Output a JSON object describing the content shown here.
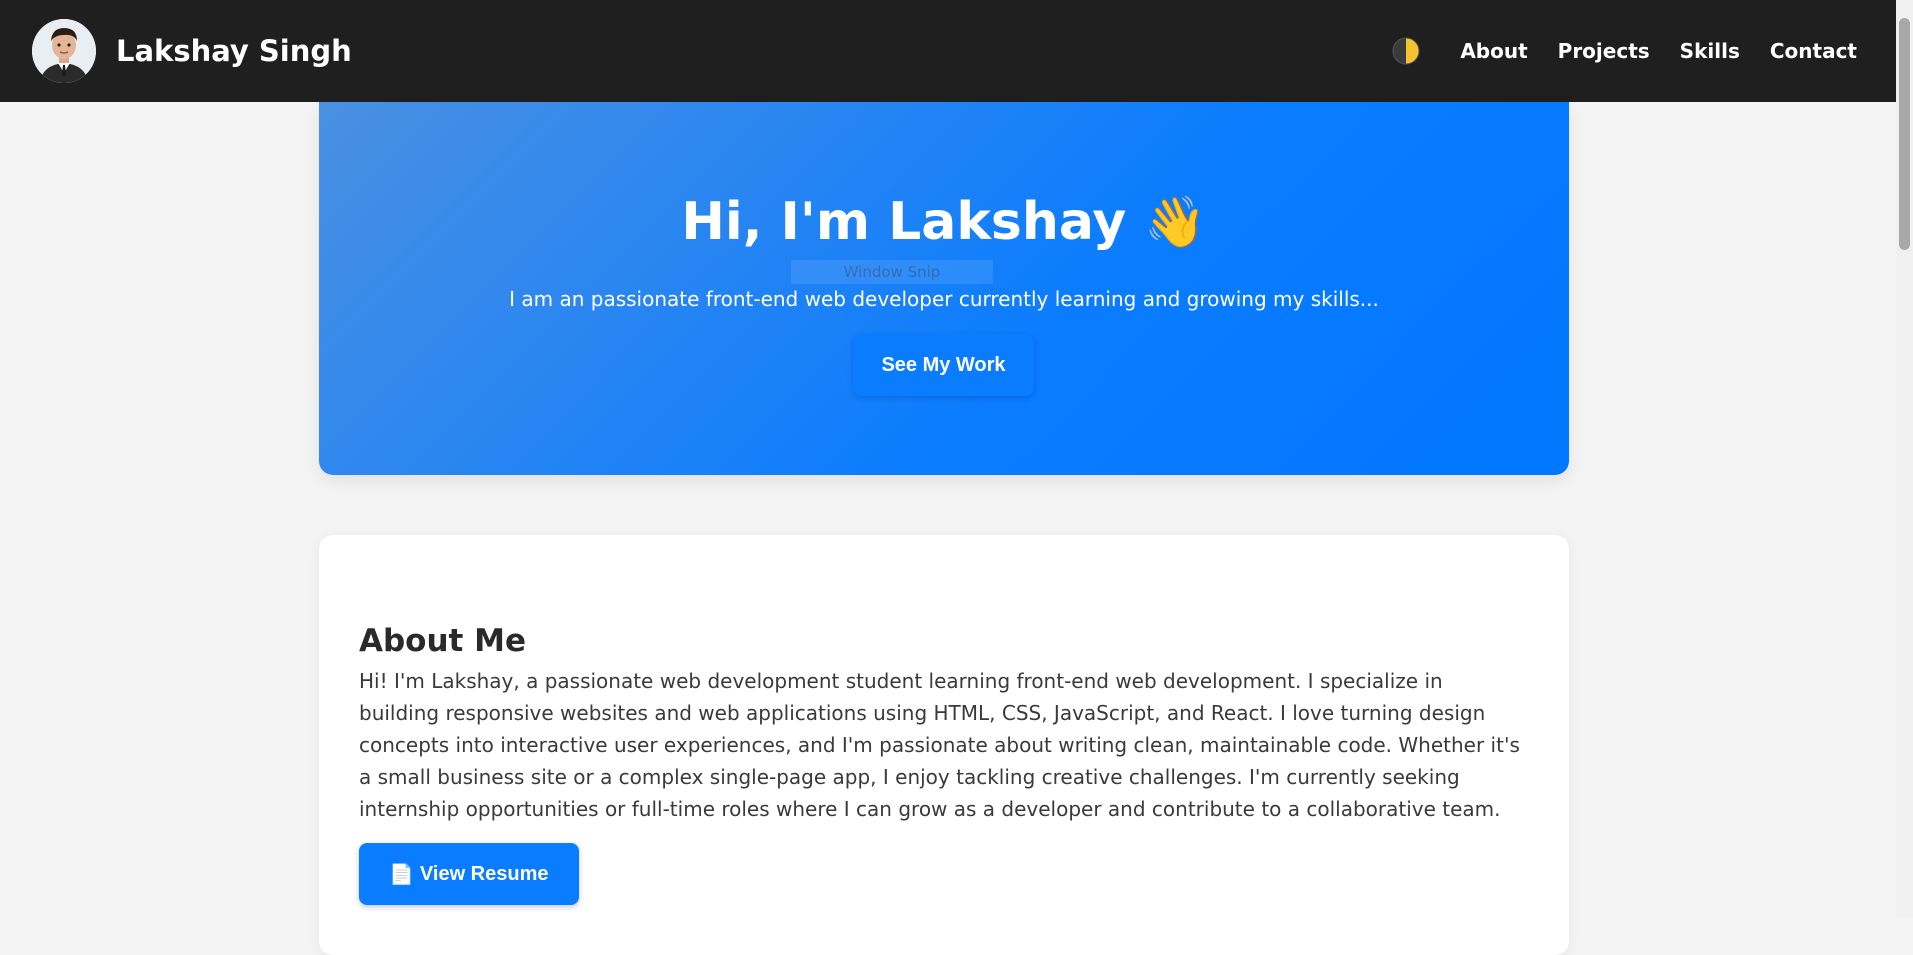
{
  "header": {
    "brand_name": "Lakshay Singh",
    "nav": [
      "About",
      "Projects",
      "Skills",
      "Contact"
    ],
    "avatar_icon": "user-avatar-icon",
    "theme_toggle_icon": "half-moon-icon"
  },
  "hero": {
    "title": "Hi, I'm Lakshay",
    "wave_emoji": "👋",
    "snip_label": "Window Snip",
    "subtitle": "I am an passionate front-end web developer currently learning and growing my skills...",
    "button_label": "See My Work",
    "gradient_start": "#4a90e2",
    "gradient_end": "#0077ff"
  },
  "about": {
    "title": "About Me",
    "text": "Hi! I'm Lakshay, a passionate web development student learning front-end web development. I specialize in building responsive websites and web applications using HTML, CSS, JavaScript, and React. I love turning design concepts into interactive user experiences, and I'm passionate about writing clean, maintainable code. Whether it's a small business site or a complex single-page app, I enjoy tackling creative challenges. I'm currently seeking internship opportunities or full-time roles where I can grow as a developer and contribute to a collaborative team.",
    "resume_icon": "📄",
    "resume_label": "View Resume"
  },
  "colors": {
    "navbar_bg": "#1f1f1f",
    "accent": "#0a7cff",
    "page_bg": "#f4f4f4"
  }
}
